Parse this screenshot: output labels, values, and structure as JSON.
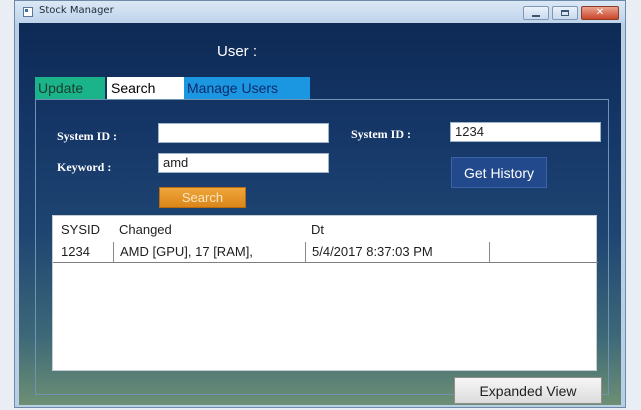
{
  "window": {
    "title": "Stock Manager"
  },
  "header": {
    "user_label": "User :"
  },
  "tabs": [
    {
      "label": "Update",
      "color": "#1bb389"
    },
    {
      "label": "Search",
      "color": "#ffffff"
    },
    {
      "label": "Manage Users",
      "color": "#1b96e0"
    }
  ],
  "search_form": {
    "system_id_label": "System ID :",
    "system_id_value": "",
    "keyword_label": "Keyword :",
    "keyword_value": "amd",
    "search_button": "Search"
  },
  "history_form": {
    "system_id_label": "System ID :",
    "system_id_value": "1234",
    "get_history_button": "Get History"
  },
  "results_grid": {
    "columns": [
      "SYSID",
      "Changed",
      "Dt",
      ""
    ],
    "rows": [
      [
        "1234",
        "AMD [GPU], 17 [RAM],",
        "5/4/2017 8:37:03 PM",
        ""
      ]
    ]
  },
  "footer": {
    "expanded_view_button": "Expanded View"
  },
  "colors": {
    "accent_orange": "#e09222",
    "history_blue": "#22498b",
    "close_red": "#c9462a"
  }
}
